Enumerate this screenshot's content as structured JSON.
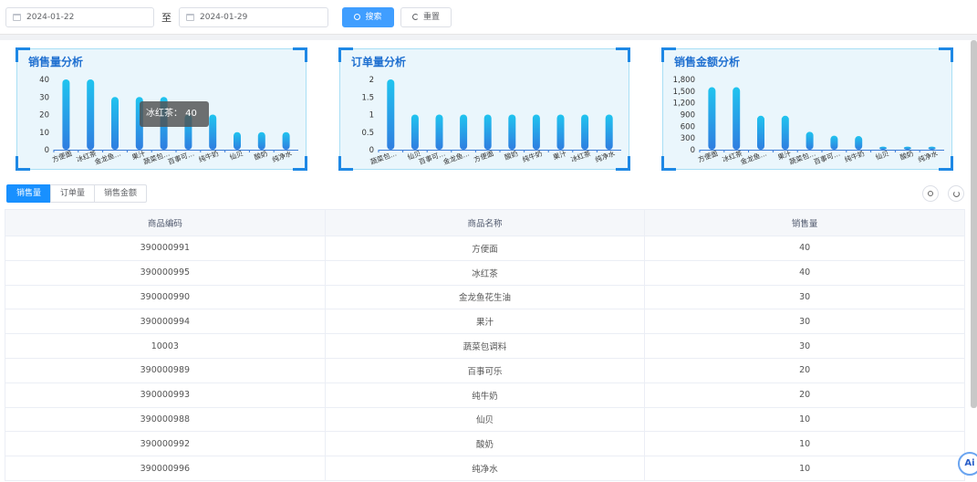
{
  "filters": {
    "start_date": "2024-01-22",
    "to_label": "至",
    "end_date": "2024-01-29",
    "search_label": "搜索",
    "reset_label": "重置"
  },
  "panels": [
    {
      "title": "销售量分析"
    },
    {
      "title": "订单量分析"
    },
    {
      "title": "销售金额分析"
    }
  ],
  "tooltip": {
    "text": "冰红茶：  40"
  },
  "chart_data": [
    {
      "type": "bar",
      "title": "销售量分析",
      "categories": [
        "方便面",
        "冰红茶",
        "金龙鱼…",
        "果汁",
        "蔬菜包…",
        "百事可…",
        "纯牛奶",
        "仙贝",
        "酸奶",
        "纯净水"
      ],
      "values": [
        40,
        40,
        30,
        30,
        30,
        20,
        20,
        10,
        10,
        10
      ],
      "yticks": [
        "0",
        "10",
        "20",
        "30",
        "40"
      ],
      "ylim": [
        0,
        40
      ],
      "grid": false
    },
    {
      "type": "bar",
      "title": "订单量分析",
      "categories": [
        "蔬菜包…",
        "仙贝",
        "百事可…",
        "金龙鱼…",
        "方便面",
        "酸奶",
        "纯牛奶",
        "果汁",
        "冰红茶",
        "纯净水"
      ],
      "values": [
        2,
        1,
        1,
        1,
        1,
        1,
        1,
        1,
        1,
        1
      ],
      "yticks": [
        "0",
        "0.5",
        "1",
        "1.5",
        "2"
      ],
      "ylim": [
        0,
        2
      ],
      "grid": false
    },
    {
      "type": "bar",
      "title": "销售金额分析",
      "categories": [
        "方便面",
        "冰红茶",
        "金龙鱼…",
        "果汁",
        "蔬菜包…",
        "百事可…",
        "纯牛奶",
        "仙贝",
        "酸奶",
        "纯净水"
      ],
      "values": [
        1600,
        1600,
        870,
        870,
        460,
        360,
        350,
        80,
        80,
        80
      ],
      "yticks": [
        "0",
        "300",
        "600",
        "900",
        "1,200",
        "1,500",
        "1,800"
      ],
      "ylim": [
        0,
        1800
      ],
      "grid": false
    }
  ],
  "tabs": [
    {
      "label": "销售量"
    },
    {
      "label": "订单量"
    },
    {
      "label": "销售金额"
    }
  ],
  "table": {
    "headers": [
      "商品编码",
      "商品名称",
      "销售量"
    ],
    "rows": [
      [
        "390000991",
        "方便面",
        "40"
      ],
      [
        "390000995",
        "冰红茶",
        "40"
      ],
      [
        "390000990",
        "金龙鱼花生油",
        "30"
      ],
      [
        "390000994",
        "果汁",
        "30"
      ],
      [
        "10003",
        "蔬菜包调料",
        "30"
      ],
      [
        "390000989",
        "百事可乐",
        "20"
      ],
      [
        "390000993",
        "纯牛奶",
        "20"
      ],
      [
        "390000988",
        "仙贝",
        "10"
      ],
      [
        "390000992",
        "酸奶",
        "10"
      ],
      [
        "390000996",
        "纯净水",
        "10"
      ]
    ]
  },
  "ai_badge": "Ai"
}
